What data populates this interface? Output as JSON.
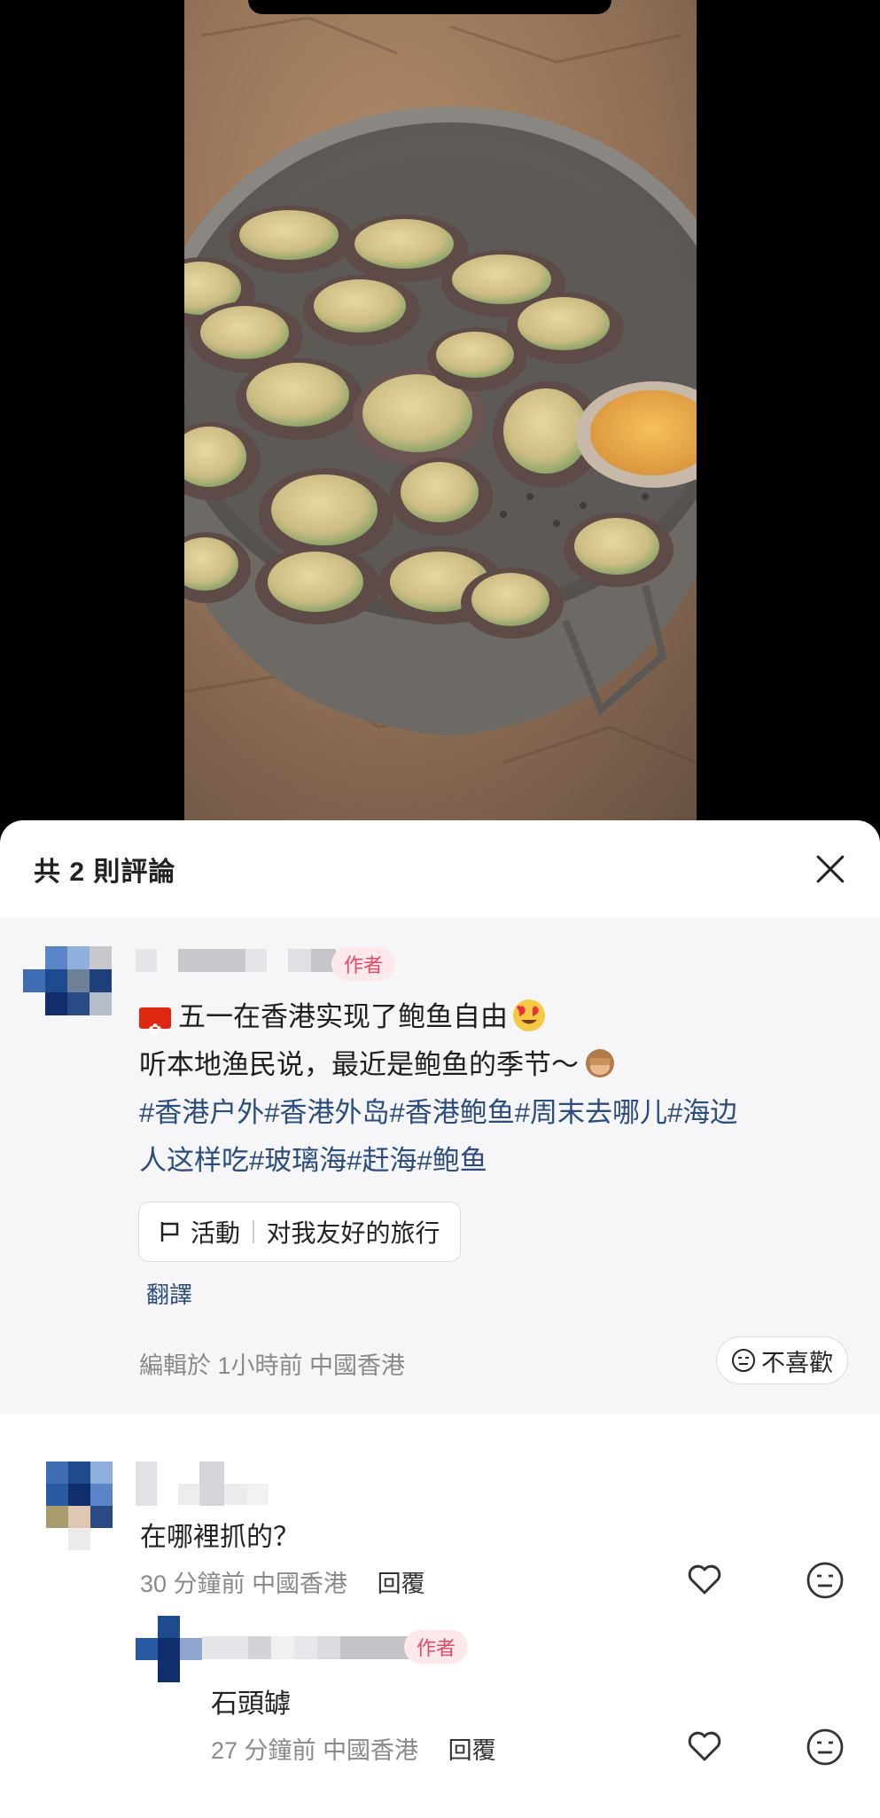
{
  "sheet": {
    "title": "共 2 則評論"
  },
  "post": {
    "author_badge": "作者",
    "line1": "五一在香港实现了鲍鱼自由",
    "line2": "听本地渔民说，最近是鲍鱼的季节～",
    "hashtags_line1": "#香港户外#香港外岛#香港鲍鱼#周末去哪儿#海边",
    "hashtags_line2": "人这样吃#玻璃海#赶海#鲍鱼",
    "event_label": "活動",
    "event_name": "对我友好的旅行",
    "translate": "翻譯",
    "meta": "編輯於  1小時前  中國香港",
    "dislike": "不喜歡"
  },
  "comments": [
    {
      "text": "在哪裡抓的？",
      "time": "30 分鐘前",
      "location": "中國香港",
      "reply": "回覆"
    }
  ],
  "replies": [
    {
      "author_badge": "作者",
      "text": "石頭罅",
      "time": "27 分鐘前",
      "location": "中國香港",
      "reply": "回覆"
    }
  ],
  "icons": {
    "close": "close-icon",
    "like": "heart-icon",
    "dislike": "meh-face-icon",
    "event": "flag-icon"
  },
  "colors": {
    "author_badge_bg": "#fde8ec",
    "author_badge_text": "#e24a63",
    "hashtag": "#2b4d7e",
    "post_bg": "#f6f6f8"
  }
}
